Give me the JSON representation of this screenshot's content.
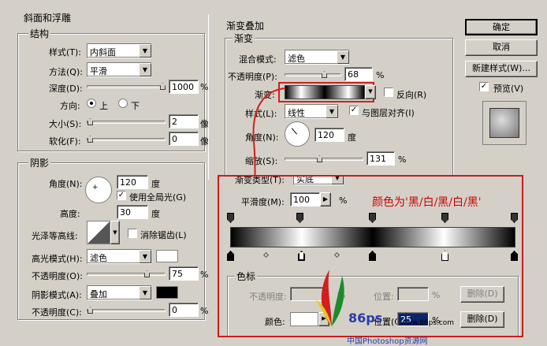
{
  "left": {
    "bevel_title": "斜面和浮雕",
    "structure_title": "结构",
    "style_label": "样式(T):",
    "style_value": "内斜面",
    "method_label": "方法(Q):",
    "method_value": "平滑",
    "depth_label": "深度(D):",
    "depth_value": "1000",
    "depth_unit": "%",
    "direction_label": "方向:",
    "dir_up": "上",
    "dir_down": "下",
    "size_label": "大小(S):",
    "size_value": "2",
    "size_unit": "像",
    "soften_label": "软化(F):",
    "soften_value": "0",
    "soften_unit": "像",
    "shading_title": "阴影",
    "angle_label": "角度(N):",
    "angle_value": "120",
    "angle_unit": "度",
    "global_light": "使用全局光(G)",
    "altitude_label": "高度:",
    "altitude_value": "30",
    "altitude_unit": "度",
    "gloss_label": "光泽等高线:",
    "antialias": "消除锯齿(L)",
    "highlight_label": "高光模式(H):",
    "highlight_value": "滤色",
    "hl_opacity_label": "不透明度(O):",
    "hl_opacity_value": "75",
    "hl_opacity_unit": "%",
    "shadow_label": "阴影模式(A):",
    "shadow_value": "叠加",
    "sh_opacity_label": "不透明度(C):",
    "sh_opacity_value": "0",
    "sh_opacity_unit": "%"
  },
  "gradient_overlay": {
    "title": "渐变叠加",
    "group": "渐变",
    "blend_label": "混合模式:",
    "blend_value": "滤色",
    "opacity_label": "不透明度(P):",
    "opacity_value": "68",
    "opacity_unit": "%",
    "gradient_label": "渐变:",
    "reverse": "反向(R)",
    "style_label": "样式(L):",
    "style_value": "线性",
    "align": "与图层对齐(I)",
    "angle_label": "角度(N):",
    "angle_value": "120",
    "angle_unit": "度",
    "scale_label": "缩放(S):",
    "scale_value": "131",
    "scale_unit": "%"
  },
  "editor": {
    "type_label": "渐变类型(T):",
    "type_value": "实底",
    "smooth_label": "平滑度(M):",
    "smooth_value": "100",
    "smooth_unit": "%",
    "annotation": "颜色为'黑/白/黑/白/黑'",
    "stops_title": "色标",
    "opacity_label": "不透明度:",
    "opacity_unit": "%",
    "location_label": "位置:",
    "location_unit": "%",
    "delete1": "删除(D)",
    "color_label": "颜色:",
    "location2_label": "位置(C):",
    "location2_value": "25",
    "location2_unit": "%",
    "delete2": "删除(D)"
  },
  "buttons": {
    "ok": "确定",
    "cancel": "取消",
    "new_style": "新建样式(W)...",
    "preview": "预览(V)"
  },
  "watermark": {
    "brand": "86ps",
    "url": "www.86ps.com",
    "caption": "中国Photoshop资源网"
  },
  "colors": {
    "accent_red": "#d11f1f",
    "annotation_color": "#cc0000",
    "highlight_swatch": "#ffffff",
    "shadow_swatch": "#000000"
  }
}
